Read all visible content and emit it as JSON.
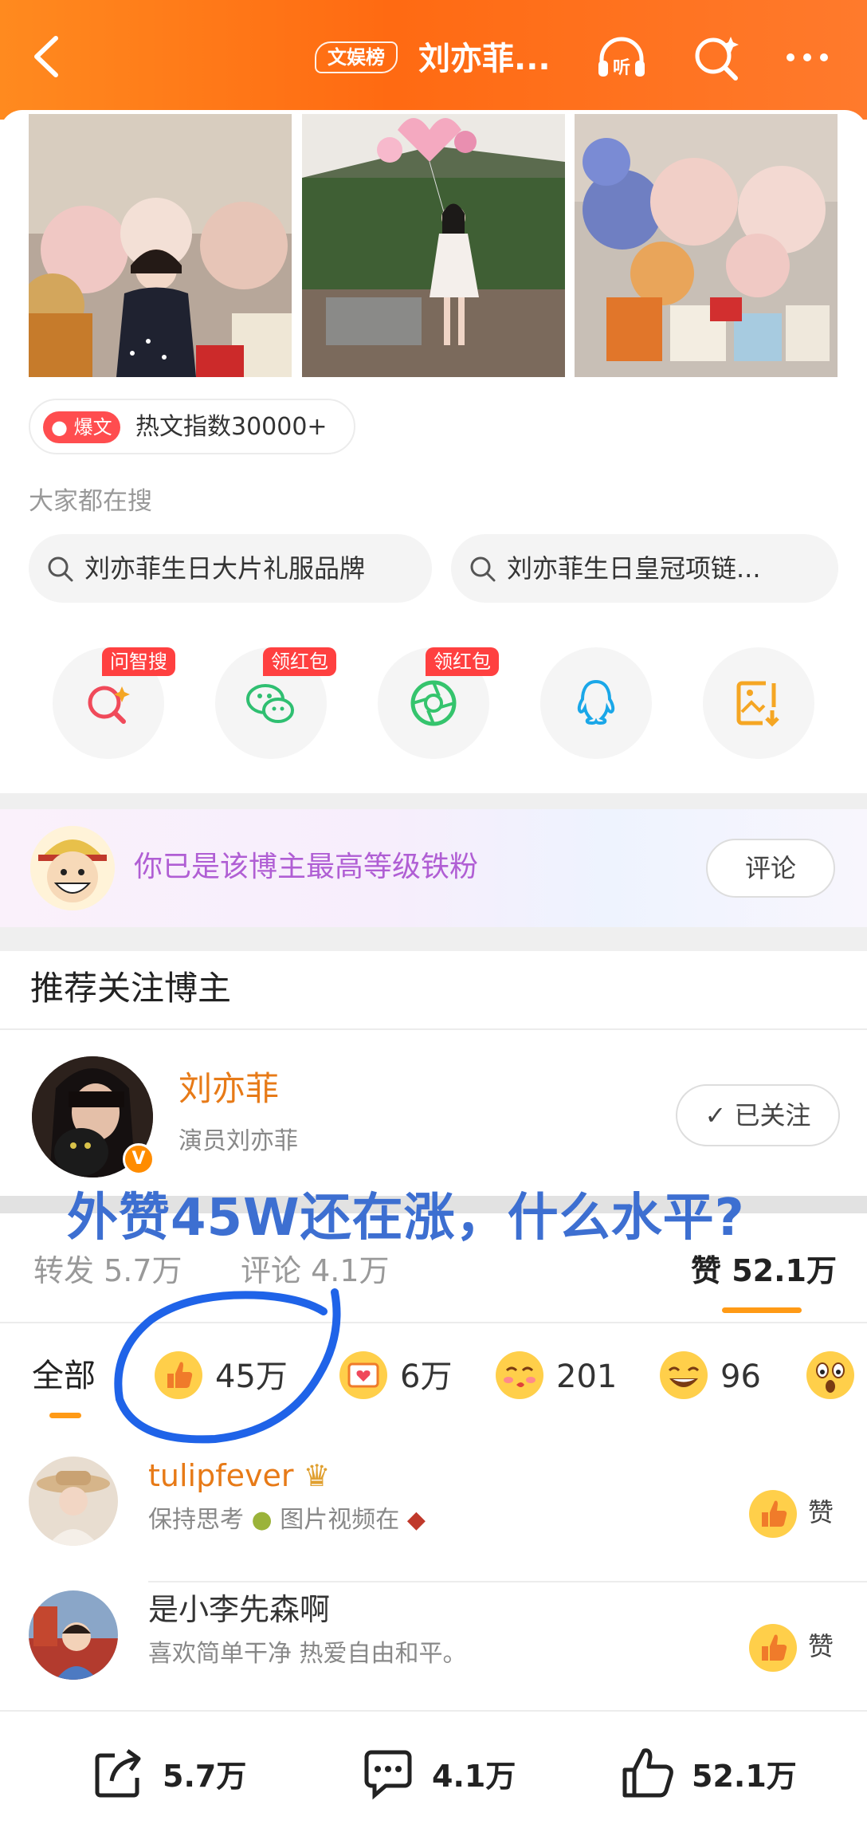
{
  "header": {
    "badge": "文娱榜",
    "title": "刘亦菲...",
    "back_icon": "chevron-left-icon",
    "listen_icon": "headphones-icon",
    "search_icon": "search-sparkle-icon",
    "more_icon": "more-dots-icon"
  },
  "hot": {
    "tag": "爆文",
    "text": "热文指数30000+"
  },
  "search": {
    "heading": "大家都在搜",
    "chips": [
      "刘亦菲生日大片礼服品牌",
      "刘亦菲生日皇冠项链..."
    ]
  },
  "share": [
    {
      "tag": "问智搜",
      "icon": "ai-search-icon"
    },
    {
      "tag": "领红包",
      "icon": "wechat-icon"
    },
    {
      "tag": "领红包",
      "icon": "moments-icon"
    },
    {
      "tag": "",
      "icon": "qq-icon"
    },
    {
      "tag": "",
      "icon": "save-image-icon"
    }
  ],
  "fan": {
    "text": "你已是该博主最高等级铁粉",
    "comment_label": "评论"
  },
  "recommend": {
    "title": "推荐关注博主",
    "name": "刘亦菲",
    "desc": "演员刘亦菲",
    "follow_label": "已关注"
  },
  "overlay_caption": "外赞45W还在涨，什么水平?",
  "stats": {
    "repost_label": "转发",
    "repost": "5.7万",
    "comment_label": "评论",
    "comment": "4.1万",
    "like_label": "赞",
    "like": "52.1万"
  },
  "reactions": {
    "all_label": "全部",
    "items": [
      {
        "icon": "thumbs-up-emoji",
        "count": "45万"
      },
      {
        "icon": "heart-card-emoji",
        "count": "6万"
      },
      {
        "icon": "kiss-emoji",
        "count": "201"
      },
      {
        "icon": "laughing-emoji",
        "count": "96"
      },
      {
        "icon": "surprised-emoji",
        "count": ""
      }
    ]
  },
  "users": [
    {
      "name": "tulipfever",
      "desc_a": "保持思考",
      "desc_b": "图片视频在",
      "like_label": "赞",
      "name_color": "#e77a17"
    },
    {
      "name": "是小李先森啊",
      "desc_a": "喜欢简单干净",
      "desc_b": "热爱自由和平。",
      "like_label": "赞",
      "name_color": "#333333"
    }
  ],
  "bottom": {
    "repost": "5.7万",
    "comment": "4.1万",
    "like": "52.1万"
  },
  "colors": {
    "accent": "#ff7a1a",
    "fan_text": "#b05ed4",
    "overlay": "#3d6fd1",
    "circle": "#1f63e8"
  }
}
